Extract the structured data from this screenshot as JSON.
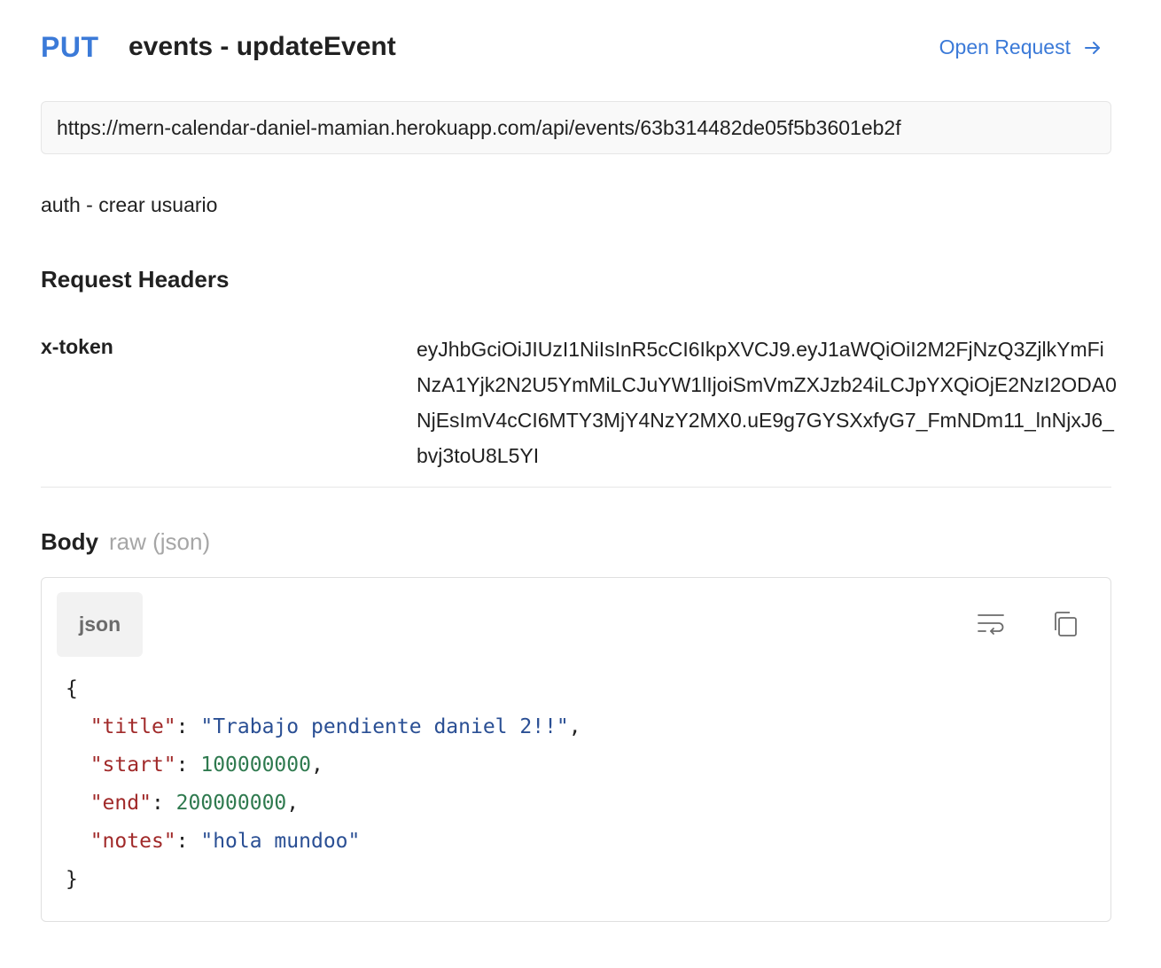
{
  "request": {
    "method": "PUT",
    "name": "events - updateEvent",
    "open_label": "Open Request",
    "url": "https://mern-calendar-daniel-mamian.herokuapp.com/api/events/63b314482de05f5b3601eb2f",
    "description": "auth - crear usuario"
  },
  "headers_section": {
    "title": "Request Headers",
    "rows": [
      {
        "key": "x-token",
        "value": "eyJhbGciOiJIUzI1NiIsInR5cCI6IkpXVCJ9.eyJ1aWQiOiI2M2FjNzQ3ZjlkYmFiNzA1Yjk2N2U5YmMiLCJuYW1lIjoiSmVmZXJzb24iLCJpYXQiOjE2NzI2ODA0NjEsImV4cCI6MTY3MjY4NzY2MX0.uE9g7GYSXxfyG7_FmNDm11_lnNjxJ6_bvj3toU8L5YI"
      }
    ]
  },
  "body_section": {
    "title": "Body",
    "subtitle": "raw (json)",
    "lang_label": "json",
    "icons": {
      "wrap": "text-wrap-icon",
      "copy": "copy-icon"
    },
    "code": {
      "open": "{",
      "close": "}",
      "lines": [
        {
          "key": "\"title\"",
          "value": "\"Trabajo pendiente daniel 2!!\"",
          "type": "string",
          "trail": ","
        },
        {
          "key": "\"start\"",
          "value": "100000000",
          "type": "number",
          "trail": ","
        },
        {
          "key": "\"end\"",
          "value": "200000000",
          "type": "number",
          "trail": ","
        },
        {
          "key": "\"notes\"",
          "value": "\"hola mundoo\"",
          "type": "string",
          "trail": ""
        }
      ]
    }
  },
  "colors": {
    "accent": "#3b7ad8",
    "json_key": "#a12a2a",
    "json_string": "#2a4f94",
    "json_number": "#2f7a4f"
  }
}
